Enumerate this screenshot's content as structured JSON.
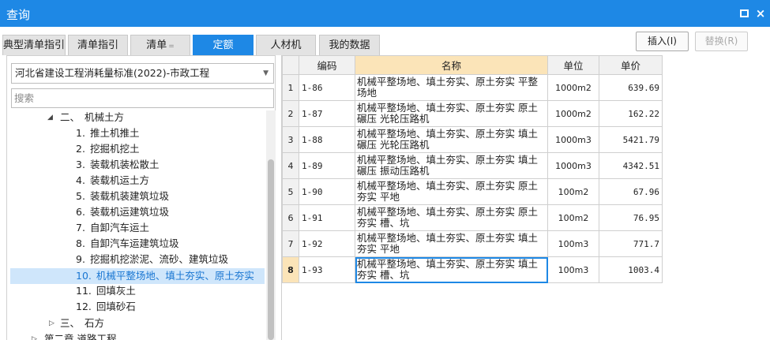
{
  "window": {
    "title": "查询",
    "maximize_icon": "maximize-icon",
    "close_icon": "close-icon",
    "close_glyph": "×"
  },
  "tabs": [
    {
      "label": "典型清单指引",
      "active": false
    },
    {
      "label": "清单指引",
      "active": false
    },
    {
      "label": "清单",
      "active": false,
      "caret": "="
    },
    {
      "label": "定额",
      "active": true
    },
    {
      "label": "人材机",
      "active": false
    },
    {
      "label": "我的数据",
      "active": false
    }
  ],
  "actions": {
    "insert_label": "插入(I)",
    "replace_label": "替换(R)"
  },
  "left": {
    "library_select": "河北省建设工程消耗量标准(2022)-市政工程",
    "search_placeholder": "搜索",
    "tree": [
      {
        "num": "二、",
        "label": "机械土方",
        "expanded": true,
        "level": 1
      },
      {
        "num": "1.",
        "label": "推土机推土",
        "level": 2
      },
      {
        "num": "2.",
        "label": "挖掘机挖土",
        "level": 2
      },
      {
        "num": "3.",
        "label": "装载机装松散土",
        "level": 2
      },
      {
        "num": "4.",
        "label": "装载机运土方",
        "level": 2
      },
      {
        "num": "5.",
        "label": "装载机装建筑垃圾",
        "level": 2
      },
      {
        "num": "6.",
        "label": "装载机运建筑垃圾",
        "level": 2
      },
      {
        "num": "7.",
        "label": "自卸汽车运土",
        "level": 2
      },
      {
        "num": "8.",
        "label": "自卸汽车运建筑垃圾",
        "level": 2
      },
      {
        "num": "9.",
        "label": "挖掘机挖淤泥、流砂、建筑垃圾",
        "level": 2
      },
      {
        "num": "10.",
        "label": "机械平整场地、填土夯实、原土夯实",
        "level": 2,
        "selected": true
      },
      {
        "num": "11.",
        "label": "回填灰土",
        "level": 2
      },
      {
        "num": "12.",
        "label": "回填砂石",
        "level": 2
      },
      {
        "num": "三、",
        "label": "石方",
        "expanded": false,
        "level": 1
      },
      {
        "num": "",
        "label": "第二章 道路工程",
        "expanded": false,
        "level": 0
      }
    ]
  },
  "grid": {
    "headers": [
      "编码",
      "名称",
      "单位",
      "单价"
    ],
    "rows": [
      {
        "n": "1",
        "code": "1-86",
        "name": "机械平整场地、填土夯实、原土夯实 平整场地",
        "unit": "1000m2",
        "price": "639.69"
      },
      {
        "n": "2",
        "code": "1-87",
        "name": "机械平整场地、填土夯实、原土夯实 原土碾压 光轮压路机",
        "unit": "1000m2",
        "price": "162.22"
      },
      {
        "n": "3",
        "code": "1-88",
        "name": "机械平整场地、填土夯实、原土夯实 填土碾压 光轮压路机",
        "unit": "1000m3",
        "price": "5421.79"
      },
      {
        "n": "4",
        "code": "1-89",
        "name": "机械平整场地、填土夯实、原土夯实 填土碾压 振动压路机",
        "unit": "1000m3",
        "price": "4342.51"
      },
      {
        "n": "5",
        "code": "1-90",
        "name": "机械平整场地、填土夯实、原土夯实 原土夯实 平地",
        "unit": "100m2",
        "price": "67.96"
      },
      {
        "n": "6",
        "code": "1-91",
        "name": "机械平整场地、填土夯实、原土夯实 原土夯实 槽、坑",
        "unit": "100m2",
        "price": "76.95"
      },
      {
        "n": "7",
        "code": "1-92",
        "name": "机械平整场地、填土夯实、原土夯实 填土夯实 平地",
        "unit": "100m3",
        "price": "771.7"
      },
      {
        "n": "8",
        "code": "1-93",
        "name": "机械平整场地、填土夯实、原土夯实 填土夯实 槽、坑",
        "unit": "100m3",
        "price": "1003.4",
        "current": true
      }
    ]
  },
  "colors": {
    "accent": "#1e88e5",
    "selected_bg": "#cfe6fb",
    "header_highlight": "#fbe4b8"
  }
}
